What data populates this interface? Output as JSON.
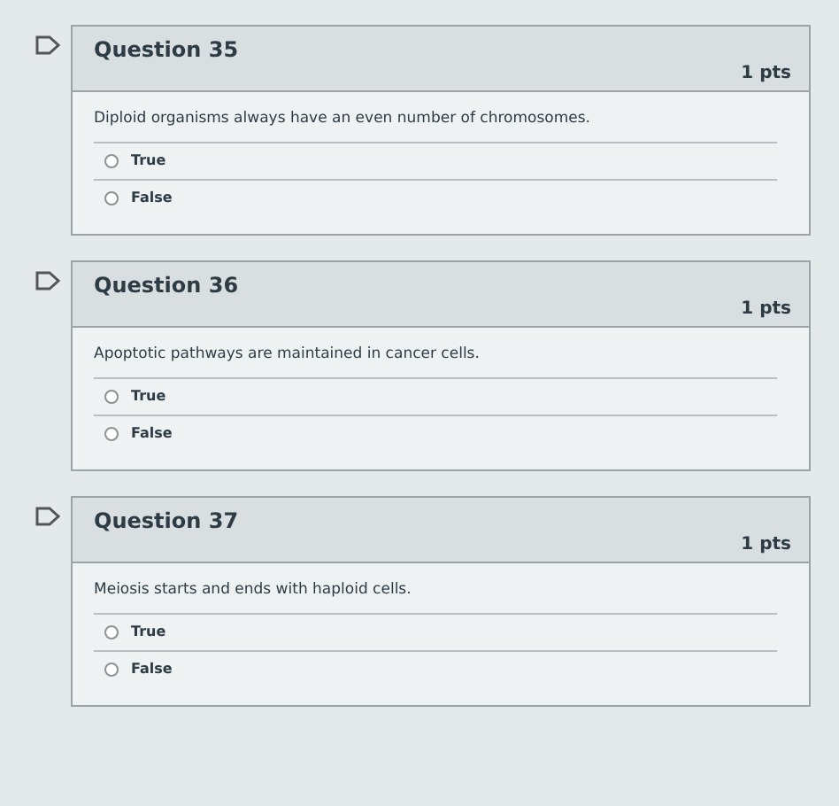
{
  "questions": [
    {
      "title": "Question 35",
      "points": "1 pts",
      "flagged": false,
      "text": "Diploid organisms always have an even number of chromosomes.",
      "answers": [
        {
          "label": "True",
          "selected": false
        },
        {
          "label": "False",
          "selected": false
        }
      ]
    },
    {
      "title": "Question 36",
      "points": "1 pts",
      "flagged": false,
      "text": "Apoptotic pathways are maintained in cancer cells.",
      "answers": [
        {
          "label": "True",
          "selected": false
        },
        {
          "label": "False",
          "selected": false
        }
      ]
    },
    {
      "title": "Question 37",
      "points": "1 pts",
      "flagged": false,
      "text": "Meiosis starts and ends with haploid cells.",
      "answers": [
        {
          "label": "True",
          "selected": false
        },
        {
          "label": "False",
          "selected": false
        }
      ]
    }
  ]
}
